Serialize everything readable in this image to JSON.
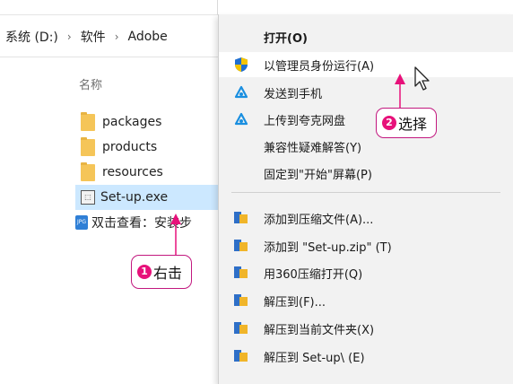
{
  "explorer": {
    "breadcrumb": [
      "系统 (D:)",
      "软件",
      "Adobe"
    ],
    "breadcrumb_separator": "›",
    "column_header": "名称",
    "files": [
      {
        "name": "packages",
        "type": "folder"
      },
      {
        "name": "products",
        "type": "folder"
      },
      {
        "name": "resources",
        "type": "folder"
      },
      {
        "name": "Set-up.exe",
        "type": "exe",
        "selected": true
      },
      {
        "name": "双击查看：安装步",
        "type": "jpg"
      }
    ]
  },
  "callouts": {
    "right_click": {
      "number": "1",
      "text": "右击"
    },
    "select": {
      "number": "2",
      "text": "选择"
    }
  },
  "context_menu": {
    "items": [
      {
        "label": "打开(O)",
        "icon": "none",
        "bold": true
      },
      {
        "label": "以管理员身份运行(A)",
        "icon": "shield-icon",
        "hover": true
      },
      {
        "label": "发送到手机",
        "icon": "cloud-sync-icon"
      },
      {
        "label": "上传到夸克网盘",
        "icon": "cloud-sync-icon"
      },
      {
        "label": "兼容性疑难解答(Y)",
        "icon": "none"
      },
      {
        "label": "固定到\"开始\"屏幕(P)",
        "icon": "none"
      },
      {
        "label": "添加到压缩文件(A)...",
        "icon": "archive-icon"
      },
      {
        "label": "添加到 \"Set-up.zip\" (T)",
        "icon": "archive-icon"
      },
      {
        "label": "用360压缩打开(Q)",
        "icon": "archive-icon"
      },
      {
        "label": "解压到(F)...",
        "icon": "archive-icon"
      },
      {
        "label": "解压到当前文件夹(X)",
        "icon": "archive-icon"
      },
      {
        "label": "解压到 Set-up\\ (E)",
        "icon": "archive-icon"
      }
    ]
  },
  "colors": {
    "accent_pink": "#e7117a",
    "selection_blue": "#cce8ff",
    "menu_bg": "#f2f2f2"
  }
}
